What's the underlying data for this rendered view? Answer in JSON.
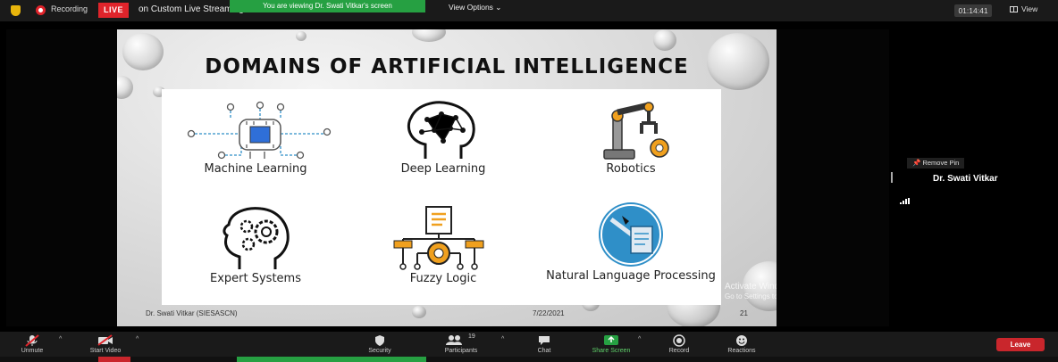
{
  "topbar": {
    "recording_label": "Recording",
    "live_label": "LIVE",
    "stream_label": "on Custom Live Streaming Service",
    "viewing_label": "You are viewing Dr. Swati Vitkar's screen",
    "view_options_label": "View Options ⌄",
    "timer": "01:14:41",
    "view_label": "View"
  },
  "slide": {
    "title": "DOMAINS OF ARTIFICIAL INTELLIGENCE",
    "items": [
      {
        "label": "Machine Learning",
        "icon": "chip-circuit-icon"
      },
      {
        "label": "Deep Learning",
        "icon": "brain-network-icon"
      },
      {
        "label": "Robotics",
        "icon": "robot-arm-icon"
      },
      {
        "label": "Expert Systems",
        "icon": "head-gears-icon"
      },
      {
        "label": "Fuzzy Logic",
        "icon": "flow-gear-icon"
      },
      {
        "label": "Natural Language Processing",
        "icon": "document-tools-icon"
      }
    ],
    "footer_presenter": "Dr. Swati Vitkar (SIESASCN)",
    "footer_date": "7/22/2021",
    "footer_page": "21",
    "watermark_line1": "Activate Windows",
    "watermark_line2": "Go to Settings to activate Windows."
  },
  "right_panel": {
    "remove_pin_label": "Remove Pin",
    "speaker_name": "Dr. Swati Vitkar"
  },
  "toolbar": {
    "unmute": "Unmute",
    "start_video": "Start Video",
    "security": "Security",
    "participants": "Participants",
    "participants_count": "19",
    "chat": "Chat",
    "share_screen": "Share Screen",
    "record": "Record",
    "reactions": "Reactions",
    "leave": "Leave"
  },
  "colors": {
    "accent_green": "#26a042",
    "live_red": "#e0242b",
    "leave_red": "#c9262c",
    "icon_orange": "#f0a01e",
    "icon_blue": "#2f8fc8"
  }
}
